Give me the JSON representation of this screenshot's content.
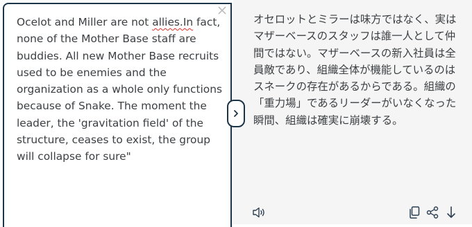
{
  "source": {
    "text_before": "Ocelot and Miller are not ",
    "misspelled_word": "allies.In",
    "text_after": " fact, none of the Mother Base staff are buddies. All new Mother Base recruits used to be enemies and the organization as a whole only functions because of Snake. The moment the leader, the 'gravitation field' of the structure, ceases to exist, the group will collapse for sure\"",
    "clear_icon": "close-icon"
  },
  "swap": {
    "icon": "chevron-right-icon"
  },
  "target": {
    "text": "オセロットとミラーは味方ではなく、実はマザーベースのスタッフは誰一人として仲間ではない。マザーベースの新入社員は全員敵であり、組織全体が機能しているのはスネークの存在があるからである。組織の「重力場」であるリーダーがいなくなった瞬間、組織は確実に崩壊する。",
    "toolbar": {
      "listen_icon": "speaker-icon",
      "copy_icon": "copy-icon",
      "share_icon": "share-icon",
      "download_icon": "download-icon"
    }
  },
  "colors": {
    "text": "#3c4043",
    "border": "#1c3448",
    "target_bg": "#f5f5f5",
    "spellcheck": "#d93025",
    "icon": "#2b3f52"
  }
}
